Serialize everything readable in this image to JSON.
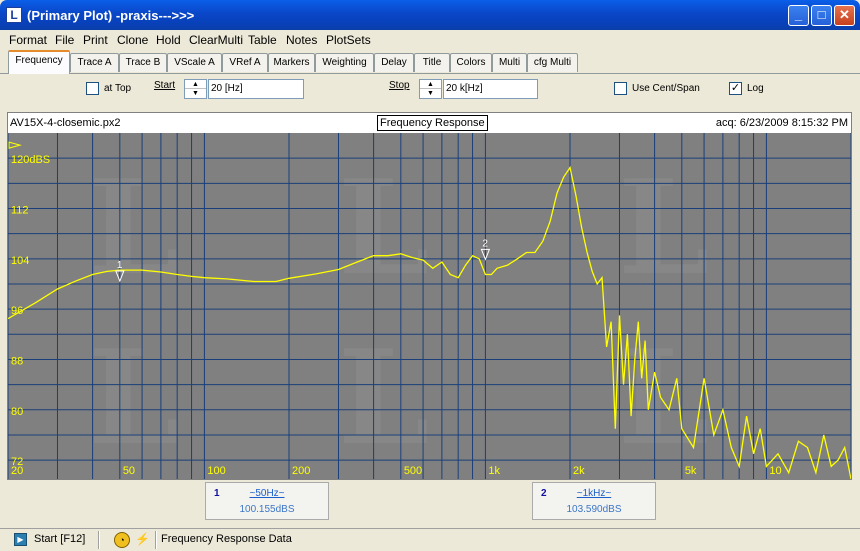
{
  "window": {
    "title": "(Primary Plot) -praxis--->>>",
    "app_icon": "L"
  },
  "menu": [
    "Format",
    "File",
    "Print",
    "Clone",
    "Hold",
    "ClearMulti",
    "Table",
    "Notes",
    "PlotSets"
  ],
  "tabs": [
    "Frequency",
    "Trace A",
    "Trace B",
    "VScale A",
    "VRef A",
    "Markers",
    "Weighting",
    "Delay",
    "Title",
    "Colors",
    "Multi",
    "cfg Multi"
  ],
  "active_tab": "Frequency",
  "controls": {
    "at_top_label": "at Top",
    "at_top_checked": false,
    "start_label": "Start",
    "start_value": "20 [Hz]",
    "stop_label": "Stop",
    "stop_value": "20 k[Hz]",
    "cent_span_label": "Use Cent/Span",
    "cent_span_checked": false,
    "log_label": "Log",
    "log_checked": true
  },
  "plot": {
    "file": "AV15X-4-closemic.px2",
    "title": "Frequency Response",
    "acq": "acq: 6/23/2009 8:15:32 PM",
    "y_unit_label": "120dBS",
    "y_ticks": [
      "112",
      "104",
      "96",
      "88",
      "80",
      "72"
    ],
    "x_ticks": [
      "20",
      "50",
      "100",
      "200",
      "500",
      "1k",
      "2k",
      "5k",
      "10"
    ],
    "colors": {
      "background": "#808080",
      "grid": "#1a3f7a",
      "trace": "#ffff00"
    }
  },
  "chart_data": {
    "type": "line",
    "title": "Frequency Response",
    "xlabel": "",
    "ylabel": "",
    "x_scale": "log",
    "xlim": [
      20,
      20000
    ],
    "ylim": [
      69,
      124
    ],
    "x": [
      20,
      25,
      30,
      35,
      40,
      45,
      50,
      60,
      70,
      80,
      90,
      100,
      120,
      150,
      180,
      200,
      250,
      300,
      350,
      400,
      450,
      500,
      550,
      600,
      650,
      700,
      750,
      800,
      850,
      900,
      950,
      1000,
      1050,
      1100,
      1200,
      1300,
      1400,
      1500,
      1600,
      1700,
      1800,
      1900,
      2000,
      2100,
      2200,
      2300,
      2400,
      2500,
      2600,
      2700,
      2800,
      2900,
      3000,
      3100,
      3200,
      3300,
      3400,
      3500,
      3600,
      3700,
      3800,
      4000,
      4200,
      4500,
      4800,
      5000,
      5500,
      6000,
      6500,
      7000,
      7500,
      8000,
      8500,
      9000,
      9500,
      10000,
      11000,
      12000,
      13000,
      14000,
      15000,
      16000,
      17000,
      18000,
      19000,
      20000
    ],
    "series": [
      {
        "values": [
          94.5,
          97,
          99.2,
          100.5,
          101.5,
          102,
          102.2,
          102.2,
          101.9,
          101.5,
          101.2,
          101,
          100.8,
          100.4,
          100.4,
          100.9,
          101.6,
          102.3,
          103.5,
          104.5,
          104.5,
          104.8,
          104.2,
          103.8,
          102.5,
          103.5,
          101.5,
          101,
          103,
          104.5,
          104,
          101.5,
          101.5,
          102.5,
          103,
          104,
          105,
          105,
          106.8,
          110,
          114.5,
          117,
          118.5,
          114,
          109,
          105,
          102,
          100,
          101,
          90,
          94,
          77,
          95,
          84,
          92,
          79,
          88,
          94,
          85,
          91,
          80,
          86,
          82,
          80,
          85,
          77,
          74,
          85,
          76,
          80,
          74,
          71,
          79,
          73,
          77,
          71,
          73,
          70,
          75,
          74,
          70,
          76,
          71,
          72,
          74,
          69
        ]
      }
    ],
    "markers": [
      {
        "id": "1",
        "x": 50,
        "y": 100.155,
        "label": "~50Hz~",
        "value": "100.155dBS"
      },
      {
        "id": "2",
        "x": 1000,
        "y": 103.59,
        "label": "~1kHz~",
        "value": "103.590dBS"
      }
    ]
  },
  "status": {
    "start_label": "Start [F12]",
    "message": "Frequency Response Data"
  }
}
